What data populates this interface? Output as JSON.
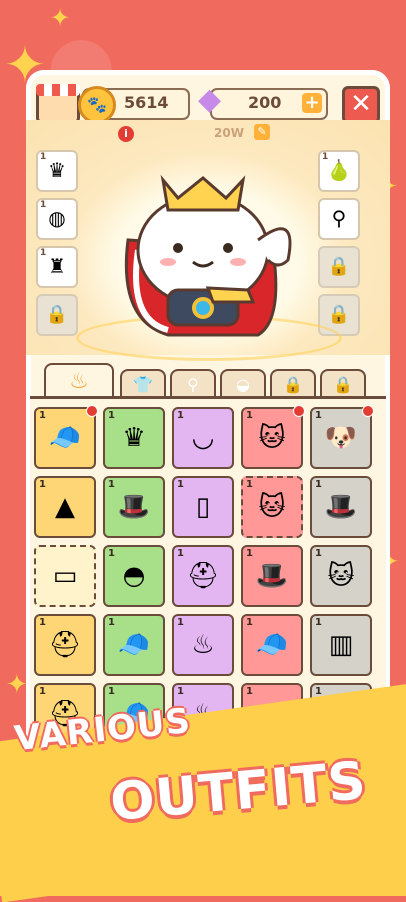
{
  "header": {
    "coins": "5614",
    "gems": "200",
    "power": "20W",
    "plus_label": "+",
    "close_label": "✕"
  },
  "colors": {
    "background": "#f06a5e",
    "panel": "#fff6e2",
    "banner": "#fecf4a",
    "yellow_cell": "#ffd675",
    "green_cell": "#a8e08a",
    "purple_cell": "#e3b6f2",
    "red_cell": "#ff9896",
    "gray_cell": "#d5d2ca"
  },
  "equip_left": [
    {
      "lv": "1",
      "icon": "crown-icon",
      "glyph": "♛"
    },
    {
      "lv": "1",
      "icon": "cape-collar-icon",
      "glyph": "◍"
    },
    {
      "lv": "1",
      "icon": "rattle-icon",
      "glyph": "♜"
    },
    {
      "lv": "",
      "icon": "lock-icon",
      "glyph": "🔒"
    }
  ],
  "equip_right": [
    {
      "lv": "1",
      "icon": "pear-icon",
      "glyph": "🍐"
    },
    {
      "lv": "",
      "icon": "spatula-icon",
      "glyph": "⚲"
    },
    {
      "lv": "",
      "icon": "lock-icon",
      "glyph": "🔒"
    },
    {
      "lv": "",
      "icon": "lock-icon",
      "glyph": "🔒"
    }
  ],
  "tabs": [
    "chef-hat-icon",
    "shirt-icon",
    "whisk-icon",
    "egg-icon",
    "lock-icon",
    "lock-icon"
  ],
  "grid": [
    [
      "1",
      "1",
      "1",
      "1",
      "1"
    ],
    [
      "1",
      "1",
      "1",
      "1",
      "1"
    ],
    [
      "",
      "1",
      "1",
      "1",
      "1"
    ],
    [
      "1",
      "1",
      "1",
      "1",
      "1"
    ],
    [
      "1",
      "1",
      "1",
      "1",
      "1"
    ]
  ],
  "banner": {
    "line1": "VARIOUS",
    "line2": "OUTFITS"
  }
}
